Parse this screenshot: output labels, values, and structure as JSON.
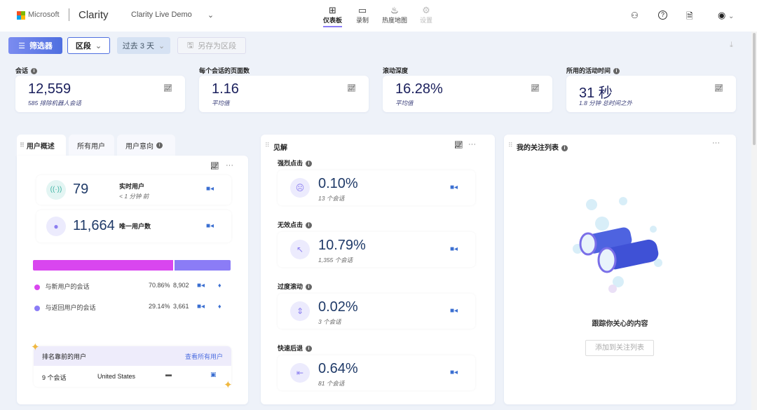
{
  "header": {
    "brand": "Microsoft",
    "product": "Clarity",
    "project": "Clarity Live Demo",
    "nav": [
      {
        "label": "仪表板",
        "icon": "dashboard-icon"
      },
      {
        "label": "录制",
        "icon": "video-icon"
      },
      {
        "label": "热度地图",
        "icon": "flame-icon"
      },
      {
        "label": "设置",
        "icon": "gear-icon"
      }
    ]
  },
  "toolbar": {
    "filter": "筛选器",
    "segment": "区段",
    "date": "过去 3 天",
    "save_segment": "另存为区段"
  },
  "metrics": [
    {
      "label": "会话",
      "value": "12,559",
      "sub": "585 排除机器人会话"
    },
    {
      "label": "每个会话的页面数",
      "value": "1.16",
      "sub": "平均值"
    },
    {
      "label": "滚动深度",
      "value": "16.28%",
      "sub": "平均值"
    },
    {
      "label": "所用的活动时间",
      "value": "31 秒",
      "sub": "1.8 分钟 总时间之外"
    }
  ],
  "users": {
    "tabs": [
      "用户概述",
      "所有用户",
      "用户意向"
    ],
    "live_value": "79",
    "live_label": "实时用户",
    "live_sub": "< 1 分钟 前",
    "unique_value": "11,664",
    "unique_label": "唯一用户数",
    "new": {
      "label": "与新用户的会话",
      "pct": "70.86%",
      "count": "8,902",
      "fraction": 0.7086,
      "color": "#d946ef"
    },
    "returning": {
      "label": "与返回用户的会话",
      "pct": "29.14%",
      "count": "3,661",
      "color": "#8b7cf6"
    },
    "top_title": "排名靠前的用户",
    "view_all": "查看所有用户",
    "top_row": {
      "sessions": "9 个会话",
      "country": "United States"
    }
  },
  "insights": {
    "title": "见解",
    "items": [
      {
        "label": "强烈点击",
        "value": "0.10%",
        "sub": "13 个会话",
        "icon": "☹"
      },
      {
        "label": "无效点击",
        "value": "10.79%",
        "sub": "1,355 个会话",
        "icon": "↖"
      },
      {
        "label": "过度滚动",
        "value": "0.02%",
        "sub": "3 个会话",
        "icon": "⇕"
      },
      {
        "label": "快速后退",
        "value": "0.64%",
        "sub": "81 个会话",
        "icon": "⇤"
      }
    ]
  },
  "watchlist": {
    "title": "我的关注列表",
    "empty_text": "跟踪你关心的内容",
    "add_button": "添加到关注列表"
  }
}
